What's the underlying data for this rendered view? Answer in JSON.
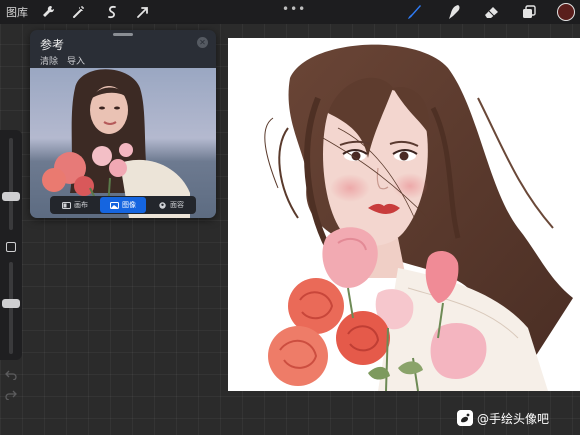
{
  "topbar": {
    "gallery_label": "图库",
    "left_tools": [
      "wrench-icon",
      "magic-wand-icon",
      "selection-icon",
      "transform-arrow-icon"
    ],
    "more_label": "•••",
    "right_tools": [
      "brush-icon",
      "smudge-icon",
      "eraser-icon",
      "layers-icon"
    ],
    "current_color": "#5a1e1c",
    "active_tool_color": "#2f7cf6"
  },
  "sidebar": {
    "size_level": 0.35,
    "opacity_level": 0.55
  },
  "reference": {
    "title": "参考",
    "clear_label": "清除",
    "import_label": "导入",
    "tabs": [
      {
        "label": "画布",
        "icon": "canvas-icon",
        "active": false
      },
      {
        "label": "图像",
        "icon": "image-icon",
        "active": true
      },
      {
        "label": "面容",
        "icon": "face-icon",
        "active": false
      }
    ]
  },
  "watermark": {
    "text": "@手绘头像吧"
  },
  "colors": {
    "hair": "#5b3a2c",
    "skin": "#f3d6cf",
    "rose": "#e85b4c",
    "pink": "#f2a8b3",
    "accent_blue": "#1565e0"
  }
}
